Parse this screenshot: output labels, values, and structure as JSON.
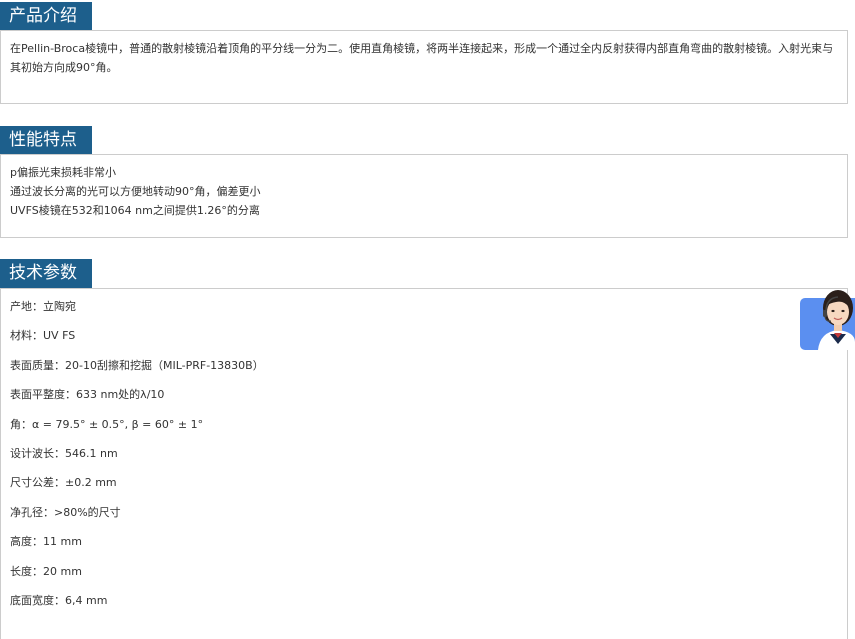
{
  "intro": {
    "title": "产品介绍",
    "text": "在Pellin-Broca棱镜中，普通的散射棱镜沿着顶角的平分线一分为二。使用直角棱镜，将两半连接起来，形成一个通过全内反射获得内部直角弯曲的散射棱镜。入射光束与其初始方向成90°角。"
  },
  "features": {
    "title": "性能特点",
    "items": [
      "p偏振光束损耗非常小",
      "通过波长分离的光可以方便地转动90°角，偏差更小",
      "UVFS棱镜在532和1064 nm之间提供1.26°的分离"
    ]
  },
  "specs": {
    "title": "技术参数",
    "items": [
      {
        "label": "产地：",
        "value": "立陶宛"
      },
      {
        "label": "材料：",
        "value": "UV FS"
      },
      {
        "label": "表面质量：",
        "value": "20-10刮擦和挖掘（MIL-PRF-13830B）"
      },
      {
        "label": "表面平整度：",
        "value": "633 nm处的λ/10"
      },
      {
        "label": "角：",
        "value": "α = 79.5° ± 0.5°, β = 60° ± 1°"
      },
      {
        "label": "设计波长：",
        "value": "546.1 nm"
      },
      {
        "label": "尺寸公差：",
        "value": "±0.2 mm"
      },
      {
        "label": "净孔径：",
        "value": ">80%的尺寸"
      },
      {
        "label": "高度：",
        "value": "11 mm"
      },
      {
        "label": "长度：",
        "value": "20 mm"
      },
      {
        "label": "底面宽度：",
        "value": "6,4 mm"
      }
    ]
  },
  "theme": {
    "header_bg": "#1d5f8c",
    "border": "#cccccc",
    "chat_bg": "#5b8ff0"
  },
  "chat_widget_icon": "customer-service-avatar-icon"
}
